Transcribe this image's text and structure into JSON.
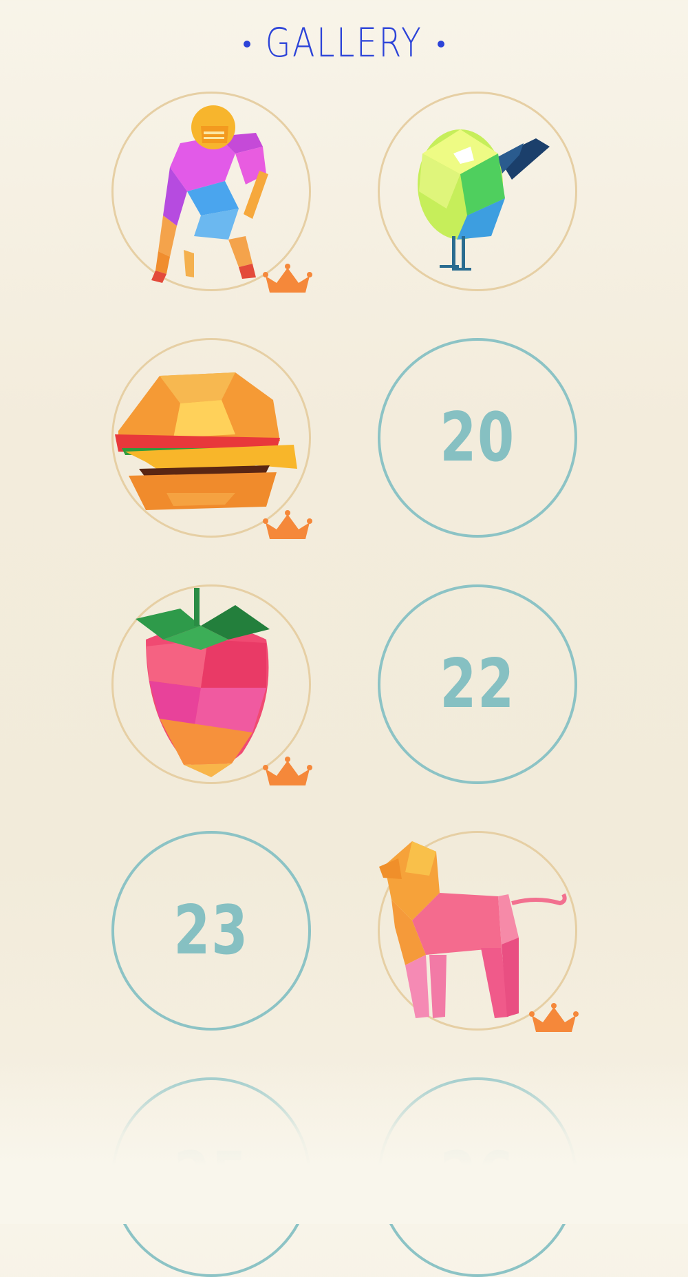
{
  "header": {
    "title": "GALLERY"
  },
  "levels": [
    {
      "status": "completed",
      "art": "football-player",
      "crown": true
    },
    {
      "status": "completed",
      "art": "bird",
      "crown": false
    },
    {
      "status": "completed",
      "art": "burger",
      "crown": true
    },
    {
      "status": "locked",
      "number": "20"
    },
    {
      "status": "completed",
      "art": "strawberry",
      "crown": true
    },
    {
      "status": "locked",
      "number": "22"
    },
    {
      "status": "locked",
      "number": "23"
    },
    {
      "status": "completed",
      "art": "lion",
      "crown": true
    },
    {
      "status": "locked",
      "number": "25"
    },
    {
      "status": "locked",
      "number": "26"
    }
  ],
  "colors": {
    "title": "#2c43d8",
    "locked_ring": "#8cc3c5",
    "done_ring": "#e6cfa4",
    "crown": "#f5883a"
  }
}
